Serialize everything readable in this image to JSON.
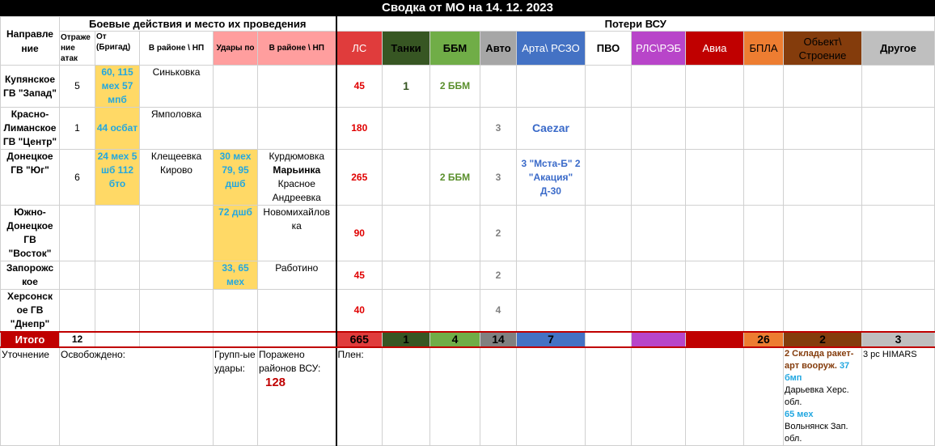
{
  "title": "Сводка от МО на 14. 12. 2023",
  "header": {
    "section_combat": "Боевые действия и место их проведения",
    "section_losses": "Потери ВСУ",
    "direction": "Направле ние",
    "repelled": "Отраже ние атак",
    "from_brigade": "От (Бригад)",
    "area_np": "В районе \\ НП",
    "strikes": "Удары по",
    "area_np2": "В районе \\ НП",
    "cols": [
      "ЛС",
      "Танки",
      "ББМ",
      "Авто",
      "Арта\\ РСЗО",
      "ПВО",
      "РЛС\\РЭБ",
      "Авиа",
      "БПЛА",
      "Обьект\\ Строение",
      "Другое"
    ]
  },
  "colors": {
    "ls": "#e03c3c",
    "tanks": "#375623",
    "bbm": "#70ad47",
    "auto": "#808080",
    "arta": "#4472c4",
    "pvo": "#ffffff",
    "rls": "#b845c9",
    "avia": "#c00000",
    "bpla": "#ed7d31",
    "object": "#843c0c",
    "other": "#bfbfbf"
  },
  "rows": [
    {
      "dir": "Купянское ГВ \"Запад\"",
      "repelled": "5",
      "brigade": "60, 115 мех 57 мпб",
      "area": "Синьковка",
      "strikes": "",
      "area2": "",
      "ls": "45",
      "tanks": "1",
      "bbm": "2 ББМ",
      "auto": "",
      "arta": ""
    },
    {
      "dir": "Красно-Лиманское ГВ \"Центр\"",
      "repelled": "1",
      "brigade": "44 осбат",
      "area": "Ямполовка",
      "strikes": "",
      "area2": "",
      "ls": "180",
      "tanks": "",
      "bbm": "",
      "auto": "3",
      "arta": "Caezar"
    },
    {
      "dir": "Донецкое ГВ \"Юг\"",
      "repelled": "6",
      "brigade": "24 мех 5 шб 112 бто",
      "area": "Клещеевка Кирово",
      "strikes": "30 мех 79, 95 дшб",
      "area2_a": "Курдюмовка",
      "area2_b": "Марьинка",
      "area2_c": "Красное Андреевка",
      "ls": "265",
      "tanks": "",
      "bbm": "2 ББМ",
      "auto": "3",
      "arta": "3 \"Мста-Б\" 2 \"Акация\" Д-30"
    },
    {
      "dir": "Южно-Донецкое ГВ \"Восток\"",
      "repelled": "",
      "brigade": "",
      "area": "",
      "strikes": "72 дшб",
      "area2": "Новомихайлов ка",
      "ls": "90",
      "tanks": "",
      "bbm": "",
      "auto": "2",
      "arta": ""
    },
    {
      "dir": "Запорожс кое",
      "repelled": "",
      "brigade": "",
      "area": "",
      "strikes": "33, 65 мех",
      "area2": "Работино",
      "ls": "45",
      "tanks": "",
      "bbm": "",
      "auto": "2",
      "arta": ""
    },
    {
      "dir": "Херсонск ое ГВ \"Днепр\"",
      "repelled": "",
      "brigade": "",
      "area": "",
      "strikes": "",
      "area2": "",
      "ls": "40",
      "tanks": "",
      "bbm": "",
      "auto": "4",
      "arta": ""
    }
  ],
  "totals": {
    "label": "Итого",
    "repelled": "12",
    "ls": "665",
    "tanks": "1",
    "bbm": "4",
    "auto": "14",
    "arta": "7",
    "pvo": "",
    "rls": "",
    "avia": "",
    "bpla": "26",
    "object": "2",
    "other": "3"
  },
  "footer": {
    "clarify": "Уточнение",
    "liberated": "Освобождено:",
    "group_strikes": "Групп-ые удары:",
    "hit_areas": "Поражено районов ВСУ:",
    "hit_areas_value": "128",
    "captured": "Плен:",
    "object_a": "2 Склада ракет-арт вооруж.",
    "object_b": "37 бмп",
    "object_c": "Дарьевка Херс. обл.",
    "object_d": "65 мех",
    "object_e": "Вольнянск Зап. обл.",
    "other": "3 рс HIMARS"
  }
}
